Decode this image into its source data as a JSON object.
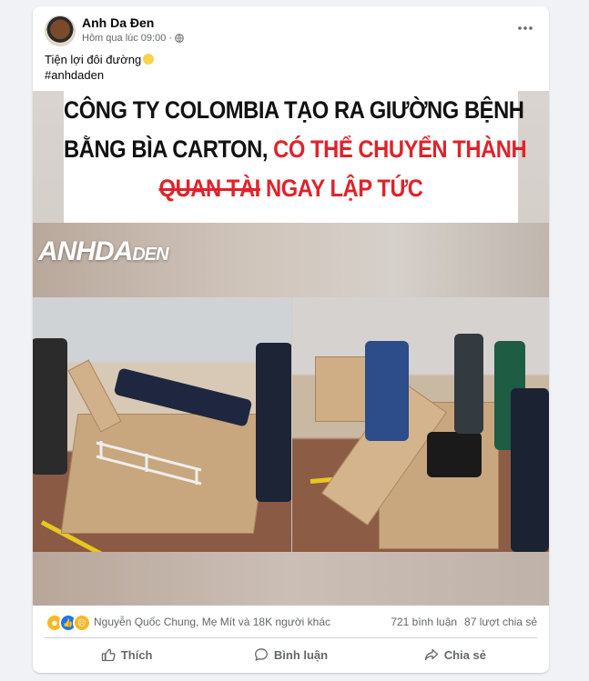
{
  "post": {
    "author": "Anh Da Đen",
    "timestamp": "Hôm qua lúc 09:00",
    "audience_icon": "globe-icon",
    "caption_line1": "Tiện lợi đôi đường",
    "caption_emoji": "pacman-emoji",
    "caption_line2": "#anhdaden"
  },
  "image": {
    "title_line1": "CÔNG TY COLOMBIA TẠO RA GIƯỜNG BỆNH",
    "title_line2_black": "BẰNG BÌA CARTON, ",
    "title_line2_red": "CÓ THỂ CHUYỂN THÀNH",
    "title_line3_strike": "QUAN TÀI",
    "title_line3_rest": " NGAY LẬP TỨC",
    "logo_main": "ANHDA",
    "logo_tail": "DEN"
  },
  "stats": {
    "reactors": "Nguyễn Quốc Chung, Mẹ Mít và 18K người khác",
    "comments": "721 bình luận",
    "shares": "87 lượt chia sẻ"
  },
  "actions": {
    "like": "Thích",
    "comment": "Bình luận",
    "share": "Chia sẻ"
  },
  "colors": {
    "accent_red": "#e0222a",
    "text_secondary": "#65676b",
    "like_blue": "#1877f2",
    "haha_yellow": "#f7b928"
  }
}
